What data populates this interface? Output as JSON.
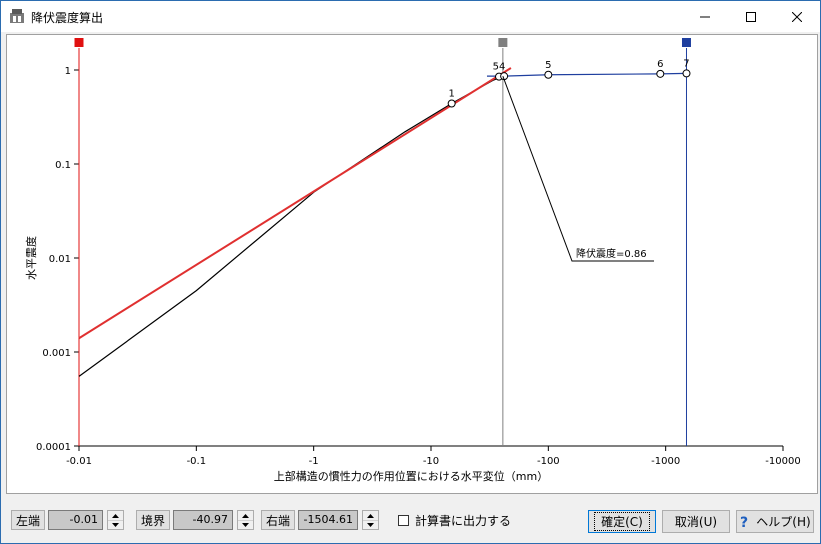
{
  "window": {
    "title": "降伏震度算出"
  },
  "chart_data": {
    "type": "line",
    "xlabel": "上部構造の慣性力の作用位置における水平変位（mm）",
    "ylabel": "水平震度",
    "x_scale": "log",
    "y_scale": "log",
    "xlim": [
      -0.01,
      -10000
    ],
    "ylim": [
      0.0001,
      1
    ],
    "x_ticks": [
      "-0.01",
      "-0.1",
      "-1",
      "-10",
      "-100",
      "-1000",
      "-10000"
    ],
    "y_ticks": [
      "1",
      "0.1",
      "0.01",
      "0.001",
      "0.0001"
    ],
    "series": [
      {
        "color": "#000000",
        "x": [
          -0.01,
          -0.1,
          -1,
          -6,
          -15,
          -34,
          -40.97
        ],
        "y": [
          0.00055,
          0.0045,
          0.05,
          0.22,
          0.44,
          0.78,
          0.86
        ]
      },
      {
        "color": "#e03030",
        "x": [
          -0.01,
          -48
        ],
        "y": [
          0.0014,
          1.05
        ]
      },
      {
        "color": "#1f3f9f",
        "x": [
          -30,
          -40.97,
          -100,
          -900,
          -1504.61
        ],
        "y": [
          0.86,
          0.86,
          0.89,
          0.91,
          0.92
        ]
      }
    ],
    "points": [
      {
        "label": "1",
        "x": -15,
        "y": 0.44
      },
      {
        "label": "54",
        "x": -38,
        "y": 0.85
      },
      {
        "label": "",
        "x": -42,
        "y": 0.86
      },
      {
        "label": "5",
        "x": -100,
        "y": 0.89
      },
      {
        "label": "6",
        "x": -900,
        "y": 0.91
      },
      {
        "label": "7",
        "x": -1504.61,
        "y": 0.92
      }
    ],
    "markers": [
      {
        "name": "left",
        "x": -0.01,
        "color": "#e01010"
      },
      {
        "name": "boundary",
        "x": -40.97,
        "color": "#808080"
      },
      {
        "name": "right",
        "x": -1504.61,
        "color": "#1f3f9f"
      }
    ],
    "annotation": {
      "text": "降伏震度=0.86",
      "x": -40.97,
      "y": 0.86
    }
  },
  "controls": {
    "left_label": "左端",
    "left_value": "-0.01",
    "boundary_label": "境界",
    "boundary_value": "-40.97",
    "right_label": "右端",
    "right_value": "-1504.61",
    "output_check_label": "計算書に出力する",
    "ok_label": "確定(C)",
    "cancel_label": "取消(U)",
    "help_label": "ヘルプ(H)"
  }
}
